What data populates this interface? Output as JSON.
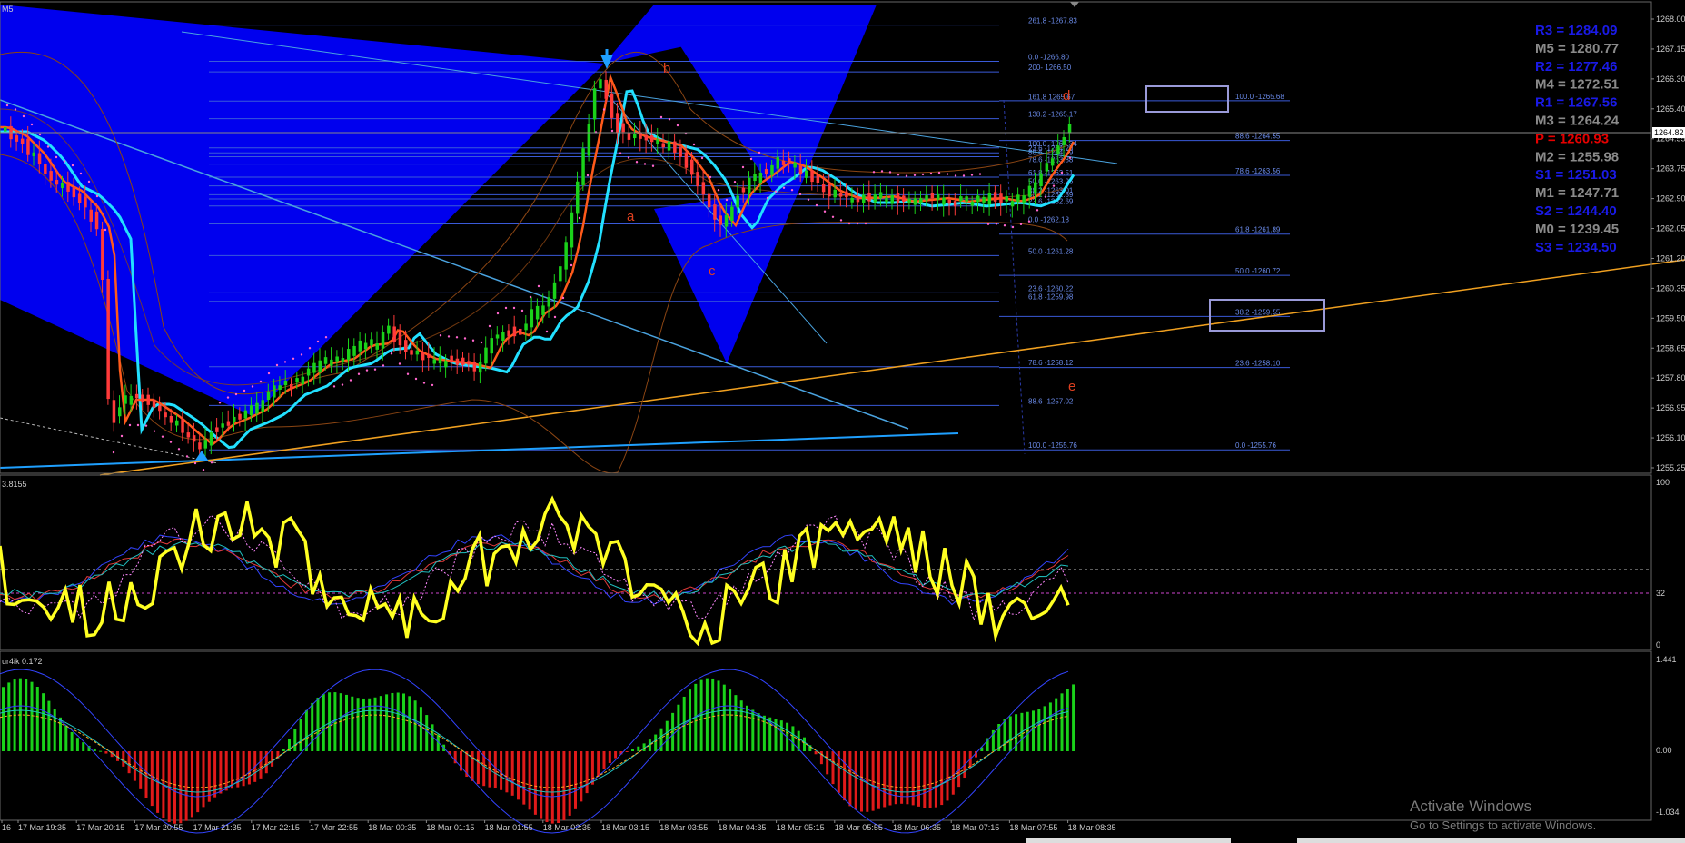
{
  "chart_data": [
    {
      "type": "candlestick",
      "title": "M5",
      "price_axis_labels": [
        "1268.00",
        "1267.15",
        "1266.30",
        "1265.40",
        "1264.55",
        "1263.75",
        "1262.90",
        "1262.05",
        "1261.20",
        "1260.35",
        "1259.50",
        "1258.65",
        "1257.80",
        "1256.95",
        "1256.10",
        "1255.25"
      ],
      "current_price_label": "1264.82",
      "time_axis_labels": [
        "16",
        "17 Mar 19:35",
        "17 Mar 20:15",
        "17 Mar 20:55",
        "17 Mar 21:35",
        "17 Mar 22:15",
        "17 Mar 22:55",
        "18 Mar 00:35",
        "18 Mar 01:15",
        "18 Mar 01:55",
        "18 Mar 02:35",
        "18 Mar 03:15",
        "18 Mar 03:55",
        "18 Mar 04:35",
        "18 Mar 05:15",
        "18 Mar 05:55",
        "18 Mar 06:35",
        "18 Mar 07:15",
        "18 Mar 07:55",
        "18 Mar 08:35"
      ],
      "ylim": [
        1255.25,
        1268.0
      ],
      "pivots": [
        {
          "label": "R3 = 1284.09",
          "color": "#1a1ae6"
        },
        {
          "label": "M5 = 1280.77",
          "color": "#8a8a8a"
        },
        {
          "label": "R2 = 1277.46",
          "color": "#1a1ae6"
        },
        {
          "label": "M4 = 1272.51",
          "color": "#8a8a8a"
        },
        {
          "label": "R1 = 1267.56",
          "color": "#1a1ae6"
        },
        {
          "label": "M3 = 1264.24",
          "color": "#8a8a8a"
        },
        {
          "label": "P  = 1260.93",
          "color": "#e60000"
        },
        {
          "label": "M2 = 1255.98",
          "color": "#8a8a8a"
        },
        {
          "label": "S1 = 1251.03",
          "color": "#1a1ae6"
        },
        {
          "label": "M1 = 1247.71",
          "color": "#8a8a8a"
        },
        {
          "label": "S2 = 1244.40",
          "color": "#1a1ae6"
        },
        {
          "label": "M0 = 1239.45",
          "color": "#8a8a8a"
        },
        {
          "label": "S3 = 1234.50",
          "color": "#1a1ae6"
        }
      ],
      "fib_left": [
        {
          "label": "261.8 -1267.83",
          "price": 1267.83
        },
        {
          "label": "0.0 -1266.80",
          "price": 1266.8
        },
        {
          "label": "200- 1266.50",
          "price": 1266.5
        },
        {
          "label": "161.8 1265.67",
          "price": 1265.67
        },
        {
          "label": "138.2 -1265.17",
          "price": 1265.17
        },
        {
          "label": "23.6 -1264.20",
          "price": 1264.2
        },
        {
          "label": "100.0 -1264.34",
          "price": 1264.34
        },
        {
          "label": "88.6 -1264.09",
          "price": 1264.09
        },
        {
          "label": "78.6 -1263.88",
          "price": 1263.88
        },
        {
          "label": "61.8 -1263.51",
          "price": 1263.51
        },
        {
          "label": "50.0 -1263.26",
          "price": 1263.26
        },
        {
          "label": "38.2 -1263.01",
          "price": 1263.01
        },
        {
          "label": "38.2 -1262.89",
          "price": 1262.89
        },
        {
          "label": "23.6 -1262.69",
          "price": 1262.69
        },
        {
          "label": "0.0 -1262.18",
          "price": 1262.18
        },
        {
          "label": "50.0 -1261.28",
          "price": 1261.28
        },
        {
          "label": "23.6 -1260.22",
          "price": 1260.22
        },
        {
          "label": "61.8 -1259.98",
          "price": 1259.98
        },
        {
          "label": "78.6 -1258.12",
          "price": 1258.12
        },
        {
          "label": "88.6 -1257.02",
          "price": 1257.02
        },
        {
          "label": "100.0 -1255.76",
          "price": 1255.76
        }
      ],
      "fib_right": [
        {
          "label": "100.0 -1265.68",
          "price": 1265.68
        },
        {
          "label": "88.6 -1264.55",
          "price": 1264.55
        },
        {
          "label": "78.6 -1263.56",
          "price": 1263.56
        },
        {
          "label": "61.8 -1261.89",
          "price": 1261.89
        },
        {
          "label": "50.0 -1260.72",
          "price": 1260.72
        },
        {
          "label": "38.2 -1259.55",
          "price": 1259.55
        },
        {
          "label": "23.6 -1258.10",
          "price": 1258.1
        },
        {
          "label": "0.0 -1255.76",
          "price": 1255.76
        }
      ],
      "wave_labels": [
        "b",
        "a",
        "c",
        "d",
        "e"
      ]
    },
    {
      "type": "line",
      "title": "3.8155",
      "ylim": [
        0,
        100
      ],
      "axis_labels": [
        "100",
        "32",
        "0"
      ]
    },
    {
      "type": "bar",
      "title": "ur4ik 0.172",
      "axis_labels": [
        "1.441",
        "0.00",
        "-1.034"
      ]
    }
  ],
  "watermark": {
    "line1": "Activate Windows",
    "line2": "Go to Settings to activate Windows."
  }
}
